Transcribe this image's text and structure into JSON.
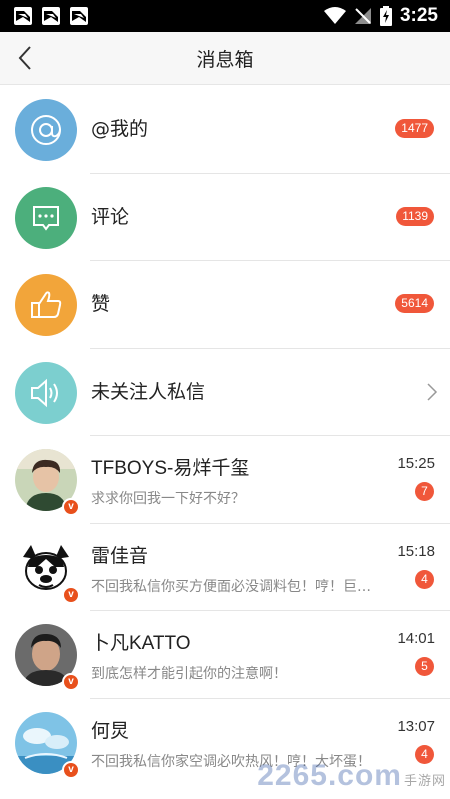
{
  "status_bar": {
    "time": "3:25",
    "app_icons": [
      "notification-app-icon",
      "notification-app-icon",
      "notification-app-icon"
    ]
  },
  "nav": {
    "back_icon": "chevron-left-icon",
    "title": "消息箱"
  },
  "categories": [
    {
      "label": "@我的",
      "badge": "1477",
      "icon": "at-icon",
      "color": "#6aaedb"
    },
    {
      "label": "评论",
      "badge": "1139",
      "icon": "chat-bubble-icon",
      "color": "#4caf7c"
    },
    {
      "label": "赞",
      "badge": "5614",
      "icon": "thumbs-up-icon",
      "color": "#f2a53a"
    },
    {
      "label": "未关注人私信",
      "badge": "",
      "icon": "speaker-icon",
      "color": "#7ccfcf"
    }
  ],
  "messages": [
    {
      "name": "TFBOYS-易烊千玺",
      "preview": "求求你回我一下好不好？",
      "time": "15:25",
      "unread": "7"
    },
    {
      "name": "雷佳音",
      "preview": "不回我私信你买方便面必没调料包！哼！巨…",
      "time": "15:18",
      "unread": "4"
    },
    {
      "name": "卜凡KATTO",
      "preview": "到底怎样才能引起你的注意啊！",
      "time": "14:01",
      "unread": "5"
    },
    {
      "name": "何炅",
      "preview": "不回我私信你家空调必吹热风！哼！大坏蛋！",
      "time": "13:07",
      "unread": "4"
    }
  ],
  "verified_mark": "v",
  "watermark": {
    "brand": "2265",
    "suffix": ".com",
    "sub": "手游网"
  },
  "colors": {
    "badge": "#f0573a",
    "verified": "#e8501c"
  }
}
